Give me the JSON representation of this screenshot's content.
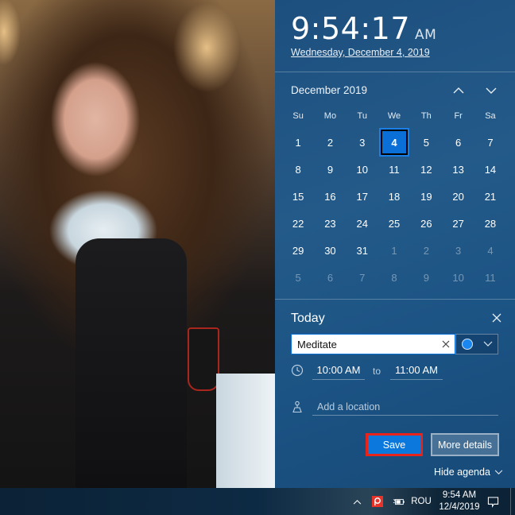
{
  "clock": {
    "time": "9:54:17",
    "ampm": "AM",
    "date_link": "Wednesday, December 4, 2019"
  },
  "calendar": {
    "month_title": "December 2019",
    "nav_up_icon": "chevron-up-icon",
    "nav_down_icon": "chevron-down-icon",
    "weekdays": [
      "Su",
      "Mo",
      "Tu",
      "We",
      "Th",
      "Fr",
      "Sa"
    ],
    "selected_day": "4",
    "days": [
      {
        "label": "1",
        "current": true
      },
      {
        "label": "2",
        "current": true
      },
      {
        "label": "3",
        "current": true
      },
      {
        "label": "4",
        "current": true,
        "today": true
      },
      {
        "label": "5",
        "current": true
      },
      {
        "label": "6",
        "current": true
      },
      {
        "label": "7",
        "current": true
      },
      {
        "label": "8",
        "current": true
      },
      {
        "label": "9",
        "current": true
      },
      {
        "label": "10",
        "current": true
      },
      {
        "label": "11",
        "current": true
      },
      {
        "label": "12",
        "current": true
      },
      {
        "label": "13",
        "current": true
      },
      {
        "label": "14",
        "current": true
      },
      {
        "label": "15",
        "current": true
      },
      {
        "label": "16",
        "current": true
      },
      {
        "label": "17",
        "current": true
      },
      {
        "label": "18",
        "current": true
      },
      {
        "label": "19",
        "current": true
      },
      {
        "label": "20",
        "current": true
      },
      {
        "label": "21",
        "current": true
      },
      {
        "label": "22",
        "current": true
      },
      {
        "label": "23",
        "current": true
      },
      {
        "label": "24",
        "current": true
      },
      {
        "label": "25",
        "current": true
      },
      {
        "label": "26",
        "current": true
      },
      {
        "label": "27",
        "current": true
      },
      {
        "label": "28",
        "current": true
      },
      {
        "label": "29",
        "current": true
      },
      {
        "label": "30",
        "current": true
      },
      {
        "label": "31",
        "current": true
      },
      {
        "label": "1",
        "current": false
      },
      {
        "label": "2",
        "current": false
      },
      {
        "label": "3",
        "current": false
      },
      {
        "label": "4",
        "current": false
      },
      {
        "label": "5",
        "current": false
      },
      {
        "label": "6",
        "current": false
      },
      {
        "label": "7",
        "current": false
      },
      {
        "label": "8",
        "current": false
      },
      {
        "label": "9",
        "current": false
      },
      {
        "label": "10",
        "current": false
      },
      {
        "label": "11",
        "current": false
      }
    ]
  },
  "agenda": {
    "title": "Today",
    "event_name": "Meditate",
    "event_color": "#1a86ef",
    "start_time": "10:00 AM",
    "to_label": "to",
    "end_time": "11:00 AM",
    "location_placeholder": "Add a location",
    "location_value": "",
    "save_label": "Save",
    "more_details_label": "More details",
    "hide_agenda_label": "Hide agenda"
  },
  "taskbar": {
    "tray_icons": [
      "show-hidden-icons-chevron",
      "app-p-icon",
      "battery-icon"
    ],
    "language": "ROU",
    "time": "9:54 AM",
    "date": "12/4/2019",
    "notification_icon": "action-center-icon"
  },
  "colors": {
    "accent": "#0b78de",
    "panel_bg": "#1d5485",
    "highlight_border": "#e8231a",
    "tray_app_icon": "#e8332a"
  }
}
